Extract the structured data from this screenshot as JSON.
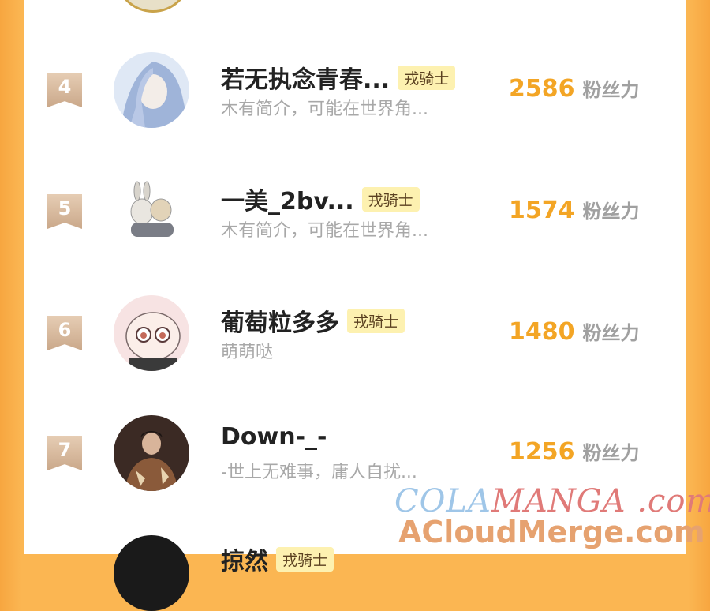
{
  "list": [
    {
      "rank": "4",
      "name": "若无执念青春...",
      "badge": "戎骑士",
      "bio": "木有简介，可能在世界角...",
      "score": "2586",
      "unit": "粉丝力"
    },
    {
      "rank": "5",
      "name": "一美_2bv...",
      "badge": "戎骑士",
      "bio": "木有简介，可能在世界角...",
      "score": "1574",
      "unit": "粉丝力"
    },
    {
      "rank": "6",
      "name": "葡萄粒多多",
      "badge": "戎骑士",
      "bio": "萌萌哒",
      "score": "1480",
      "unit": "粉丝力"
    },
    {
      "rank": "7",
      "name": "Down-_-",
      "badge": "",
      "bio": "-世上无难事，庸人自扰...",
      "score": "1256",
      "unit": "粉丝力"
    }
  ],
  "partial_row": {
    "name": "掠然",
    "badge": "戎骑士"
  },
  "watermark": {
    "line1_part1": "COLA",
    "line1_part2": "MANGA",
    "line1_part3": ".com",
    "line2": "ACloudMerge.com"
  },
  "colors": {
    "accent": "#f3a525",
    "badge_bg": "#fdf1b0",
    "rank_badge": "#caa88a"
  }
}
